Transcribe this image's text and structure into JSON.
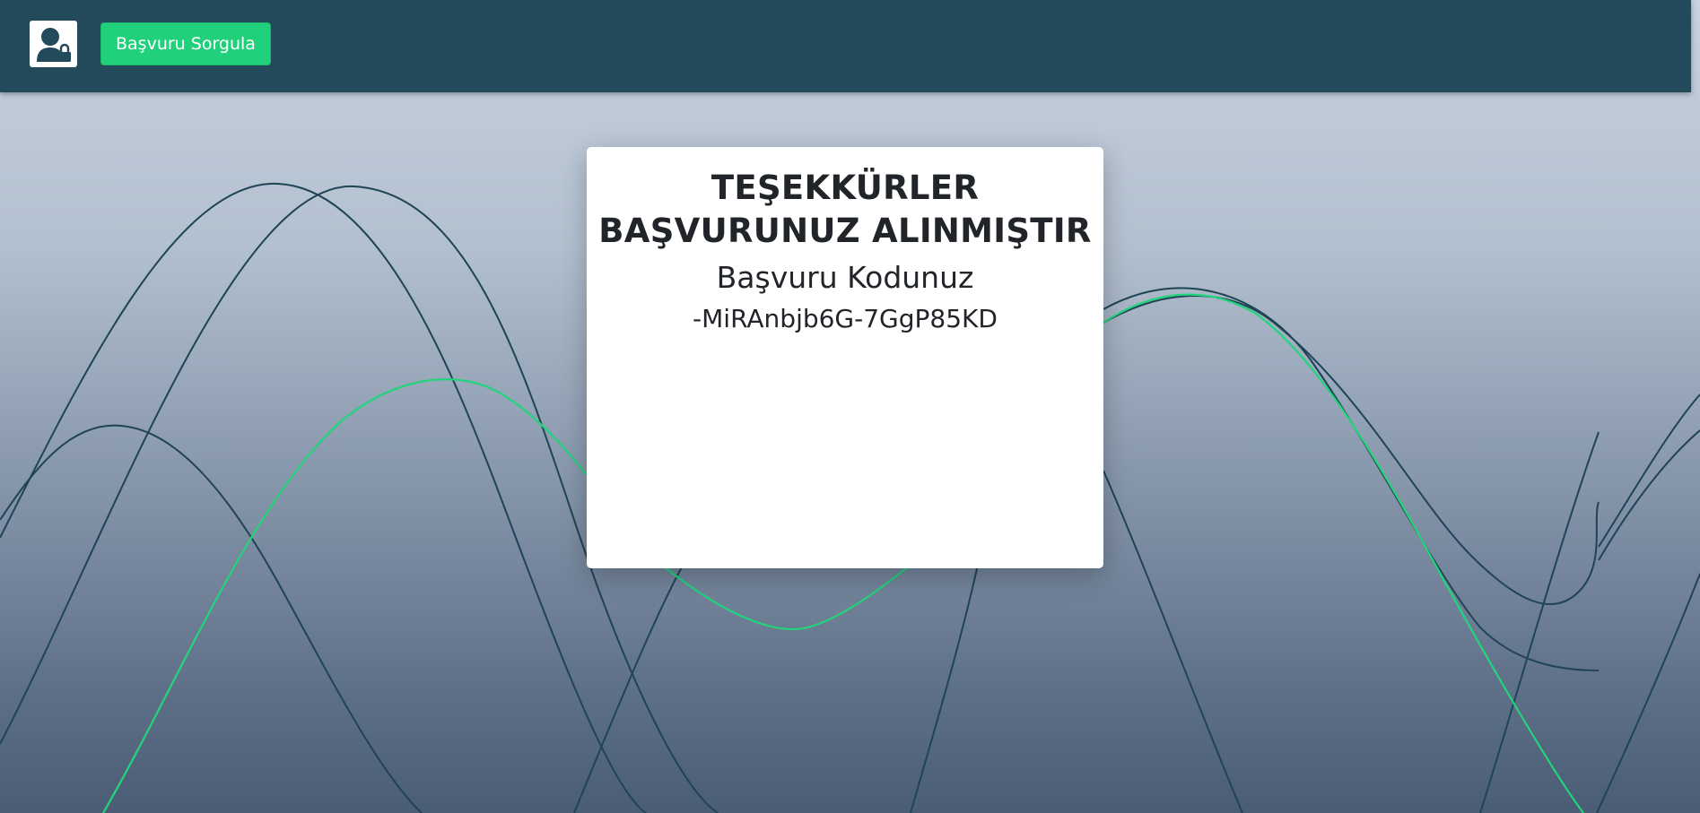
{
  "header": {
    "logo_icon": "user-lock-icon",
    "query_button_label": "Başvuru Sorgula",
    "background_color": "#234a5b",
    "button_color": "#21d07a"
  },
  "card": {
    "title": "TEŞEKKÜRLER BAŞVURUNUZ ALINMIŞTIR",
    "code_label": "Başvuru Kodunuz",
    "code_value": "-MiRAnbjb6G-7GgP85KD"
  },
  "background": {
    "line_color": "#1f4455",
    "accent_line_color": "#22d47c"
  }
}
